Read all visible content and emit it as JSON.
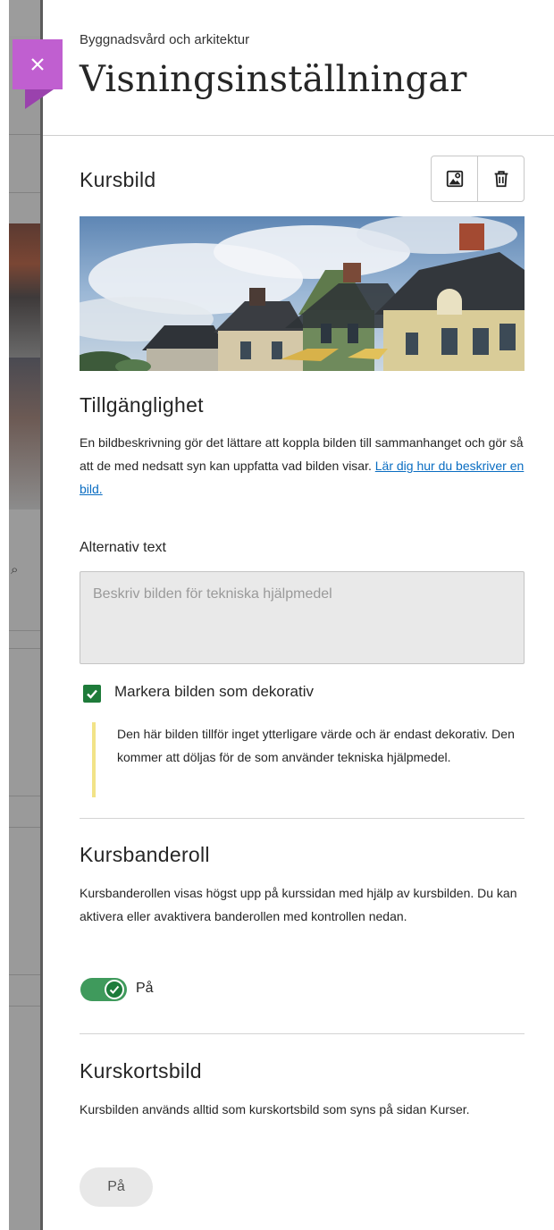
{
  "panel": {
    "breadcrumb": "Byggnadsvård och arkitektur",
    "title": "Visningsinställningar"
  },
  "course_image": {
    "heading": "Kursbild",
    "edit_button_icon": "image-edit-icon",
    "delete_button_icon": "trash-icon"
  },
  "accessibility": {
    "heading": "Tillgänglighet",
    "description": "En bildbeskrivning gör det lättare att koppla bilden till sammanhanget och gör så att de med nedsatt syn kan uppfatta vad bilden visar.",
    "link_text": "Lär dig hur du beskriver en bild.",
    "alt_label": "Alternativ text",
    "alt_placeholder": "Beskriv bilden för tekniska hjälpmedel",
    "alt_value": "",
    "decorative_label": "Markera bilden som dekorativ",
    "decorative_checked": true,
    "decorative_note": "Den här bilden tillför inget ytterligare värde och är endast dekorativ. Den kommer att döljas för de som använder tekniska hjälpmedel."
  },
  "banner": {
    "heading": "Kursbanderoll",
    "description": "Kursbanderollen visas högst upp på kurssidan med hjälp av kursbilden. Du kan aktivera eller avaktivera banderollen med kontrollen nedan.",
    "toggle_on": true,
    "toggle_label": "På"
  },
  "card_image": {
    "heading": "Kurskortsbild",
    "description": "Kursbilden används alltid som kurskortsbild som syns på sidan Kurser.",
    "state_label": "På"
  },
  "colors": {
    "accent_purple": "#c05fd0",
    "success_green": "#1e7b3a",
    "link_blue": "#0a6dc2",
    "note_yellow": "#f2e387"
  }
}
